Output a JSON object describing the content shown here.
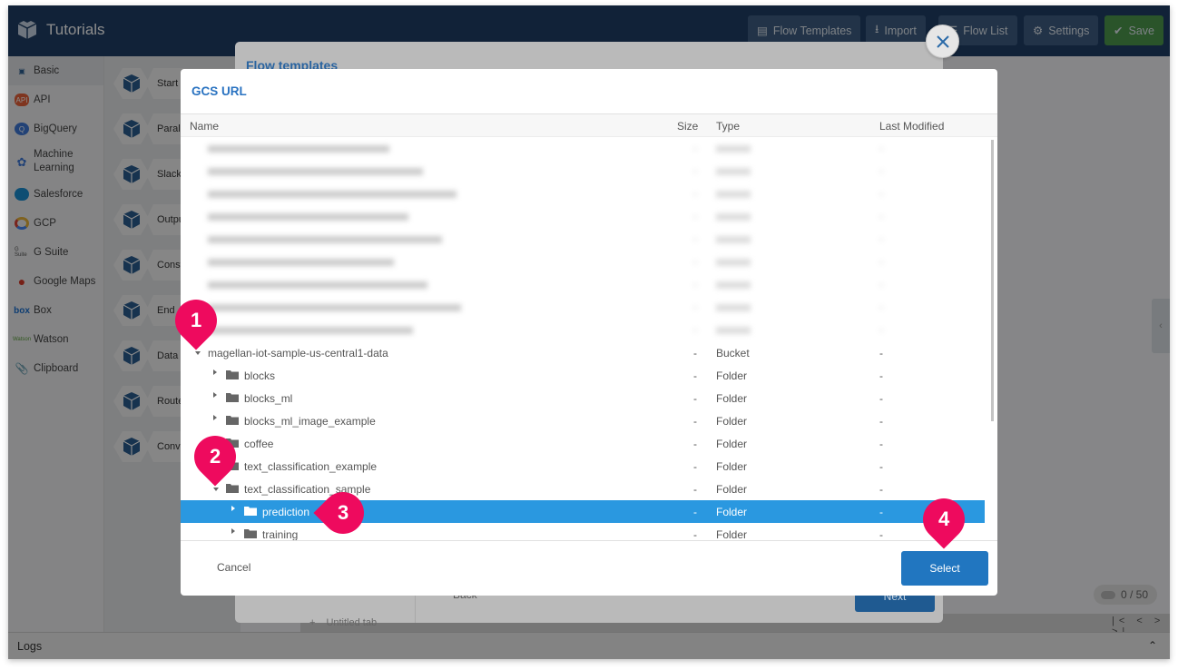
{
  "app": {
    "title": "Tutorials",
    "toolbar": {
      "flow_templates": "Flow Templates",
      "import": "Import",
      "flow_list": "Flow List",
      "settings": "Settings",
      "save": "Save"
    }
  },
  "sidebar": {
    "items": [
      {
        "label": "Basic",
        "icon": "cube-icon"
      },
      {
        "label": "API",
        "icon": "api-cloud-icon"
      },
      {
        "label": "BigQuery",
        "icon": "bigquery-icon"
      },
      {
        "label": "Machine\nLearning",
        "icon": "brain-icon"
      },
      {
        "label": "Salesforce",
        "icon": "salesforce-cloud-icon"
      },
      {
        "label": "GCP",
        "icon": "gcp-icon"
      },
      {
        "label": "G Suite",
        "icon": "gsuite-icon"
      },
      {
        "label": "Google Maps",
        "icon": "map-pin-icon"
      },
      {
        "label": "Box",
        "icon": "box-logo-icon"
      },
      {
        "label": "Watson",
        "icon": "watson-logo-icon"
      },
      {
        "label": "Clipboard",
        "icon": "clipboard-icon"
      }
    ]
  },
  "palette": {
    "blocks": [
      "Start",
      "Parall",
      "Slack",
      "Outpu",
      "Const",
      "End",
      "Data",
      "Route",
      "Conve"
    ]
  },
  "background": {
    "logs_label": "Logs",
    "counter": "0 / 50",
    "tab_label": "Untitled tab",
    "pager": "|< < > >|"
  },
  "flow_templates_modal": {
    "title": "Flow templates",
    "back_label": "Back",
    "next_label": "Next"
  },
  "gcs_dialog": {
    "title": "GCS URL",
    "columns": {
      "name": "Name",
      "size": "Size",
      "type": "Type",
      "last_modified": "Last Modified"
    },
    "blurred_rows": 9,
    "rows": [
      {
        "name": "magellan-iot-sample-us-central1-data",
        "size": "-",
        "type": "Bucket",
        "modified": "-",
        "level": 0,
        "expanded": true,
        "folder": false,
        "selected": false
      },
      {
        "name": "blocks",
        "size": "-",
        "type": "Folder",
        "modified": "-",
        "level": 1,
        "expanded": false,
        "folder": true,
        "selected": false
      },
      {
        "name": "blocks_ml",
        "size": "-",
        "type": "Folder",
        "modified": "-",
        "level": 1,
        "expanded": false,
        "folder": true,
        "selected": false
      },
      {
        "name": "blocks_ml_image_example",
        "size": "-",
        "type": "Folder",
        "modified": "-",
        "level": 1,
        "expanded": false,
        "folder": true,
        "selected": false
      },
      {
        "name": "coffee",
        "size": "-",
        "type": "Folder",
        "modified": "-",
        "level": 1,
        "expanded": false,
        "folder": true,
        "selected": false
      },
      {
        "name": "text_classification_example",
        "size": "-",
        "type": "Folder",
        "modified": "-",
        "level": 1,
        "expanded": false,
        "folder": true,
        "selected": false
      },
      {
        "name": "text_classification_sample",
        "size": "-",
        "type": "Folder",
        "modified": "-",
        "level": 1,
        "expanded": true,
        "folder": true,
        "selected": false
      },
      {
        "name": "prediction",
        "size": "-",
        "type": "Folder",
        "modified": "-",
        "level": 2,
        "expanded": false,
        "folder": true,
        "selected": true
      },
      {
        "name": "training",
        "size": "-",
        "type": "Folder",
        "modified": "-",
        "level": 2,
        "expanded": false,
        "folder": true,
        "selected": false
      }
    ],
    "cancel_label": "Cancel",
    "select_label": "Select"
  },
  "annotations": {
    "markers": [
      "1",
      "2",
      "3",
      "4"
    ],
    "color": "#ee0a5e"
  }
}
